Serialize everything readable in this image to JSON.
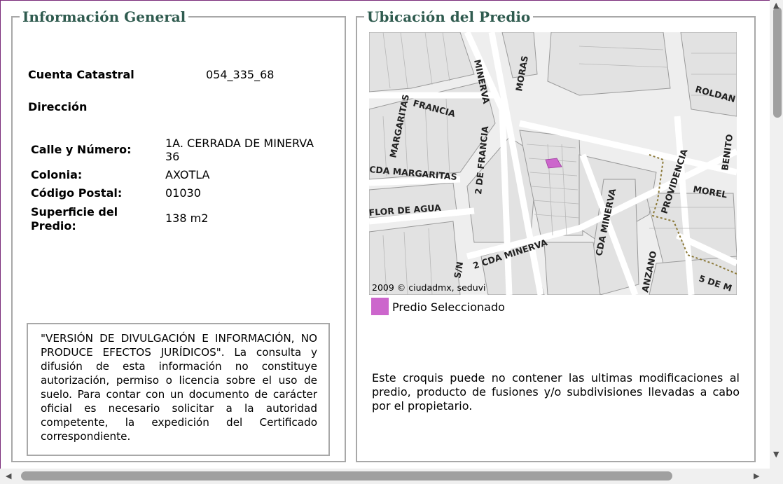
{
  "info": {
    "legend": "Información General",
    "cuenta_label": "Cuenta Catastral",
    "cuenta_value": "054_335_68",
    "direccion_label": "Dirección",
    "calle_label": "Calle y Número:",
    "calle_value_1": "1A. CERRADA DE MINERVA",
    "calle_value_2": "36",
    "colonia_label": "Colonia:",
    "colonia_value": "AXOTLA",
    "cp_label": "Código Postal:",
    "cp_value": "01030",
    "superficie_label_1": "Superficie del",
    "superficie_label_2": "Predio:",
    "superficie_value": "138 m2",
    "disclaimer": "\"VERSIÓN DE DIVULGACIÓN E INFORMACIÓN, NO PRODUCE EFECTOS JURÍDICOS\". La consulta y difusión de esta información no constituye autorización, permiso o licencia sobre el uso de suelo. Para contar con un documento de carácter oficial es necesario solicitar a la autoridad competente, la expedición del Certificado correspondiente."
  },
  "location": {
    "legend": "Ubicación del Predio",
    "map": {
      "credit": "2009 © ciudadmx, seduvi",
      "streets": [
        "MINERVA",
        "MORAS",
        "ROLDAN",
        "MARGARITAS",
        "FRANCIA",
        "2 DE FRANCIA",
        "CDA MARGARITAS",
        "FLOR DE AGUA",
        "PROVIDENCIA",
        "BENITO",
        "MOREL",
        "CDA MINERVA",
        "2 CDA MINERVA",
        "S/N",
        "ANZANO",
        "5 DE M"
      ],
      "selected_color": "#cc66cc"
    },
    "legend_item": "Predio Seleccionado",
    "note": "Este croquis puede no contener las ultimas modificaciones al predio, producto de fusiones y/o subdivisiones llevadas a cabo por el propietario."
  }
}
